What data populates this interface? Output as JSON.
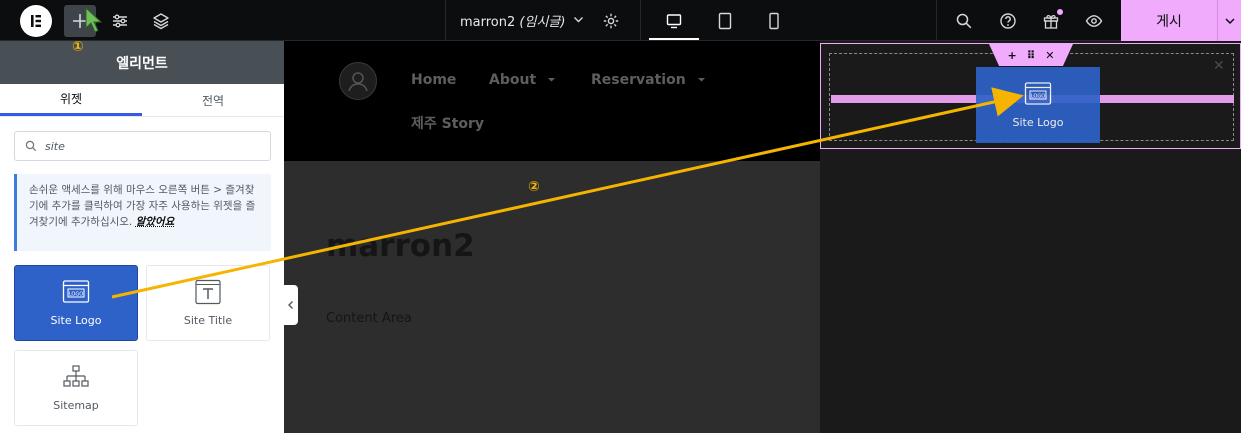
{
  "topbar": {
    "doc_name": "marron2",
    "doc_status": "(임시글)",
    "publish_label": "게시"
  },
  "annotations": {
    "step1": "①",
    "step2": "②"
  },
  "panel": {
    "title": "엘리먼트",
    "tabs": [
      {
        "label": "위젯",
        "active": true
      },
      {
        "label": "전역",
        "active": false
      }
    ],
    "search_value": "site",
    "tip_text": "손쉬운 액세스를 위해 마우스 오른쪽 버튼 > 즐겨찾기에 추가를 클릭하여 가장 자주 사용하는 위젯을 즐겨찾기에 추가하십시오.",
    "tip_link": "알았어요",
    "widgets": [
      {
        "label": "Site Logo",
        "icon": "site-logo-icon",
        "selected": true
      },
      {
        "label": "Site Title",
        "icon": "site-title-icon",
        "selected": false
      },
      {
        "label": "Sitemap",
        "icon": "sitemap-icon",
        "selected": false
      }
    ]
  },
  "canvas": {
    "nav": [
      "Home",
      "About",
      "Reservation",
      "제주 Story"
    ],
    "page_title": "marron2",
    "content_text": "Content Area"
  },
  "drop": {
    "ghost_label": "Site Logo"
  },
  "colors": {
    "accent": "#f0abfc",
    "selected_widget": "#2e62c8",
    "arrow": "#f5b400",
    "topbar": "#0c0d0e"
  }
}
